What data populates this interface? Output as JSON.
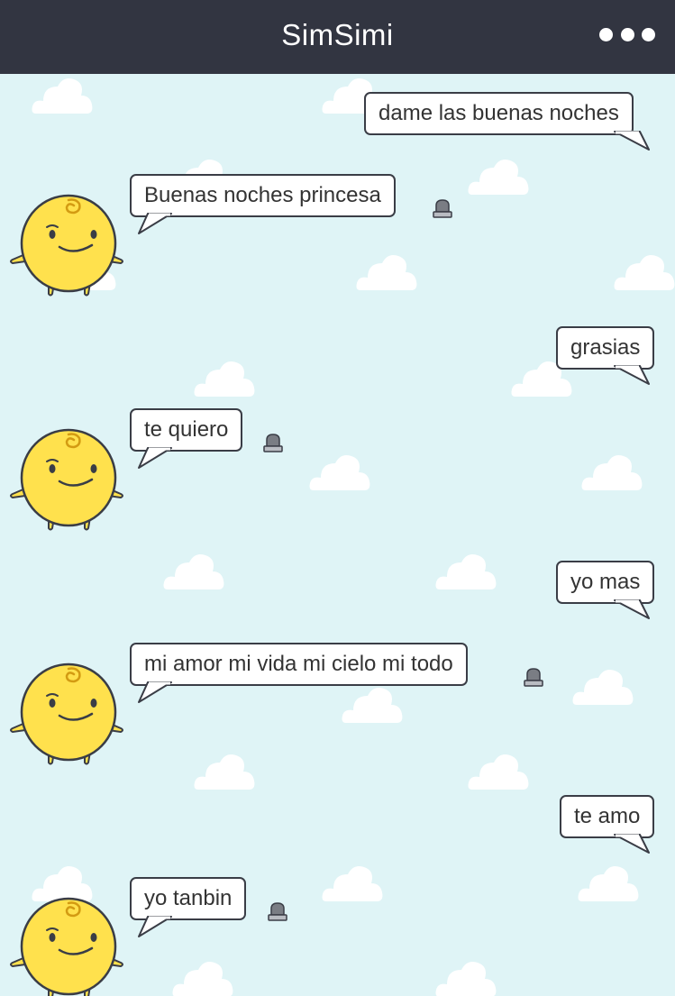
{
  "header": {
    "title": "SimSimi",
    "menu_icon": "more-dots-icon",
    "background": "#323541"
  },
  "chat": {
    "background": "#dff4f6",
    "messages": [
      {
        "sender": "user",
        "text": "dame las buenas noches"
      },
      {
        "sender": "simsimi",
        "text": "Buenas noches princesa"
      },
      {
        "sender": "user",
        "text": "grasias"
      },
      {
        "sender": "simsimi",
        "text": "te quiero"
      },
      {
        "sender": "user",
        "text": "yo mas"
      },
      {
        "sender": "simsimi",
        "text": "mi amor mi vida mi cielo mi todo"
      },
      {
        "sender": "user",
        "text": "te amo"
      },
      {
        "sender": "simsimi",
        "text": "yo tanbin"
      }
    ]
  },
  "icons": {
    "avatar": "simsimi-avatar-icon",
    "report": "report-siren-icon",
    "cloud": "cloud-icon"
  }
}
